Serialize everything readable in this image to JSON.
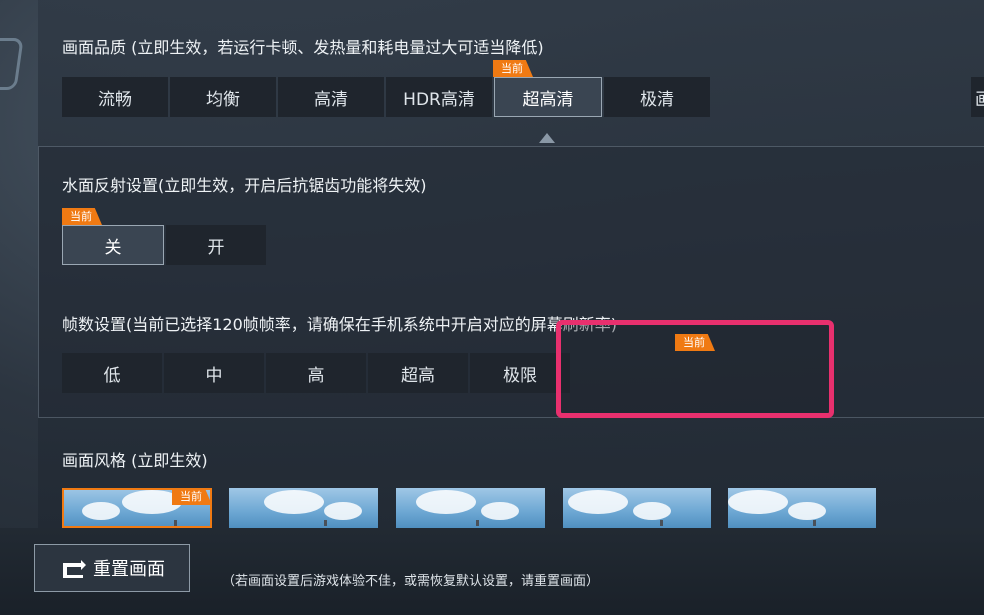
{
  "quality": {
    "title": "画面品质 (立即生效，若运行卡顿、发热量和耗电量过大可适当降低)",
    "options": [
      "流畅",
      "均衡",
      "高清",
      "HDR高清",
      "超高清",
      "极清"
    ],
    "current_label": "当前",
    "edge_label": "画"
  },
  "water": {
    "title": "水面反射设置(立即生效，开启后抗锯齿功能将失效)",
    "options": [
      "关",
      "开"
    ],
    "current_label": "当前"
  },
  "fps": {
    "title": "帧数设置(当前已选择120帧帧率，请确保在手机系统中开启对应的屏幕刷新率)",
    "options": [
      "低",
      "中",
      "高",
      "超高",
      "极限"
    ],
    "current_label": "当前"
  },
  "style": {
    "title": "画面风格 (立即生效)",
    "current_label": "当前"
  },
  "footer": {
    "reset_label": "重置画面",
    "hint": "（若画面设置后游戏体验不佳，或需恢复默认设置，请重置画面）"
  },
  "colors": {
    "badge": "#f07a13",
    "highlight": "#e8306e"
  }
}
